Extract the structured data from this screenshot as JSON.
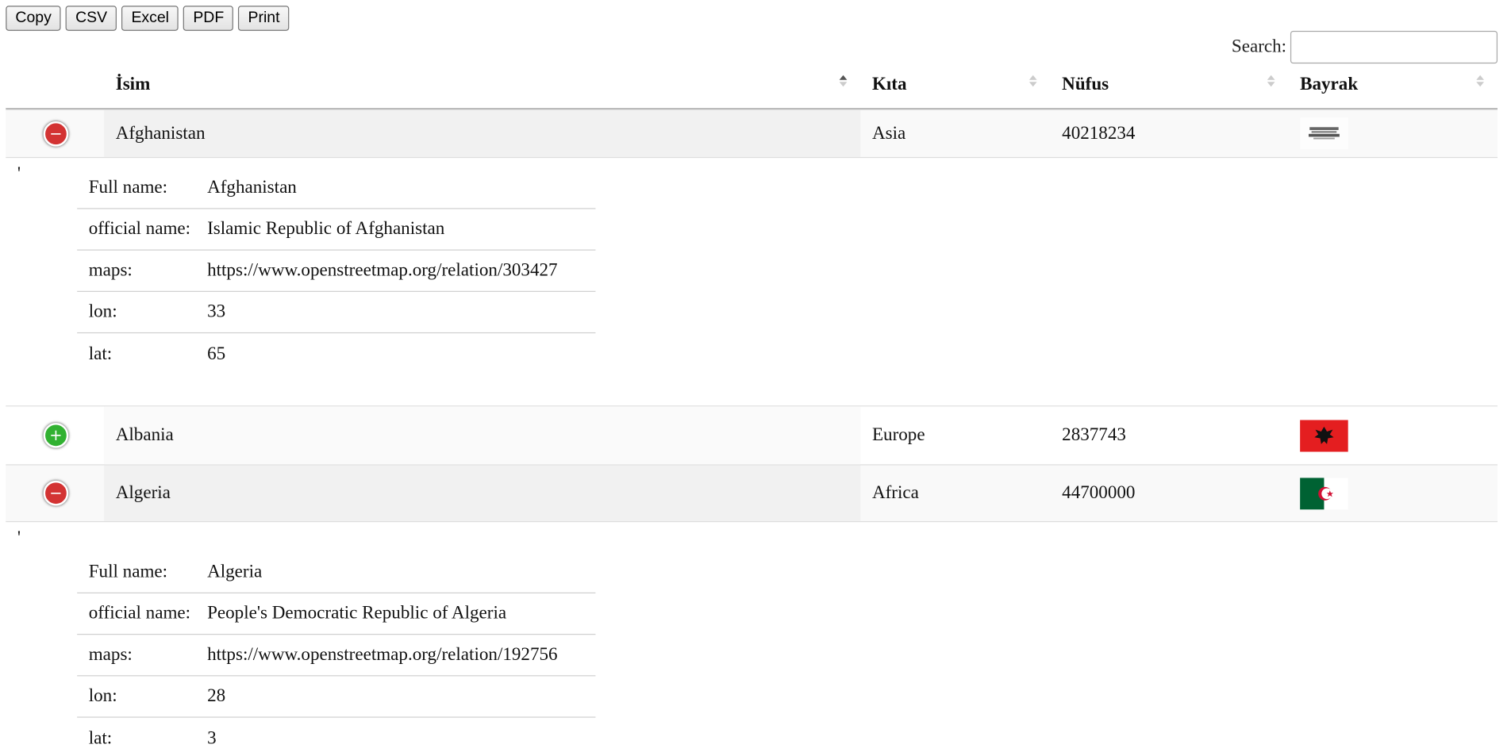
{
  "toolbar": {
    "buttons": [
      "Copy",
      "CSV",
      "Excel",
      "PDF",
      "Print"
    ]
  },
  "search": {
    "label": "Search:",
    "value": ""
  },
  "table": {
    "headers": [
      "İsim",
      "Kıta",
      "Nüfus",
      "Bayrak"
    ],
    "sorted_column": "İsim",
    "sort_direction": "ascending",
    "rows": [
      {
        "name": "Afghanistan",
        "continent": "Asia",
        "population": "40218234",
        "flag_icon": "afghanistan-flag",
        "expanded": true,
        "details": {
          "marker": "'",
          "fields": [
            {
              "label": "Full name:",
              "value": "Afghanistan"
            },
            {
              "label": "official name:",
              "value": "Islamic Republic of Afghanistan"
            },
            {
              "label": "maps:",
              "value": "https://www.openstreetmap.org/relation/303427"
            },
            {
              "label": "lon:",
              "value": "33"
            },
            {
              "label": "lat:",
              "value": "65"
            }
          ]
        }
      },
      {
        "name": "Albania",
        "continent": "Europe",
        "population": "2837743",
        "flag_icon": "albania-flag",
        "expanded": false
      },
      {
        "name": "Algeria",
        "continent": "Africa",
        "population": "44700000",
        "flag_icon": "algeria-flag",
        "expanded": true,
        "details": {
          "marker": "'",
          "fields": [
            {
              "label": "Full name:",
              "value": "Algeria"
            },
            {
              "label": "official name:",
              "value": "People's Democratic Republic of Algeria"
            },
            {
              "label": "maps:",
              "value": "https://www.openstreetmap.org/relation/192756"
            },
            {
              "label": "lon:",
              "value": "28"
            },
            {
              "label": "lat:",
              "value": "3"
            }
          ]
        }
      }
    ]
  },
  "colors": {
    "collapse_button": "#d33333",
    "expand_button": "#31b131",
    "stripe": "#f9f9f9",
    "sorted_column_stripe": "#f1f1f1"
  }
}
